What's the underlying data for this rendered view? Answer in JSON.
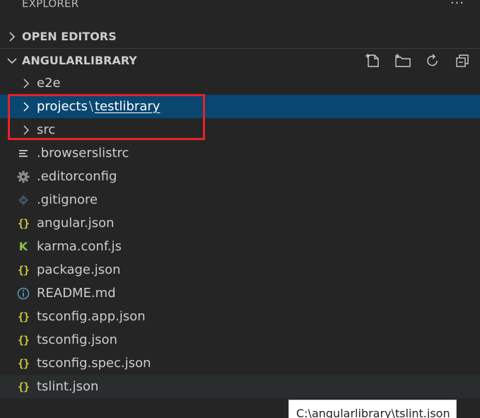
{
  "panel": {
    "title": "EXPLORER",
    "more_actions": "···"
  },
  "sections": {
    "open_editors": {
      "label": "OPEN EDITORS",
      "expanded": false
    },
    "workspace": {
      "label": "ANGULARLIBRARY",
      "expanded": true,
      "actions": [
        "new-file-icon",
        "new-folder-icon",
        "refresh-icon",
        "collapse-all-icon"
      ]
    }
  },
  "tree": {
    "e2e": "e2e",
    "projects_part1": "projects",
    "projects_sep": "\\",
    "projects_part2": "testlibrary",
    "src": "src",
    "browserslistrc": ".browserslistrc",
    "editorconfig": ".editorconfig",
    "gitignore": ".gitignore",
    "angular_json": "angular.json",
    "karma_conf": "karma.conf.js",
    "package_json": "package.json",
    "readme": "README.md",
    "tsconfig_app": "tsconfig.app.json",
    "tsconfig": "tsconfig.json",
    "tsconfig_spec": "tsconfig.spec.json",
    "tslint": "tslint.json"
  },
  "icons": {
    "json": "{}",
    "karma": "K"
  },
  "tooltip": "C:\\angularlibrary\\tslint.json",
  "colors": {
    "background": "#252526",
    "selection": "#094771",
    "hover": "#2a2d2e",
    "json_icon": "#cbcb41",
    "karma_icon": "#8dc149",
    "highlight_box": "#e8212a"
  }
}
